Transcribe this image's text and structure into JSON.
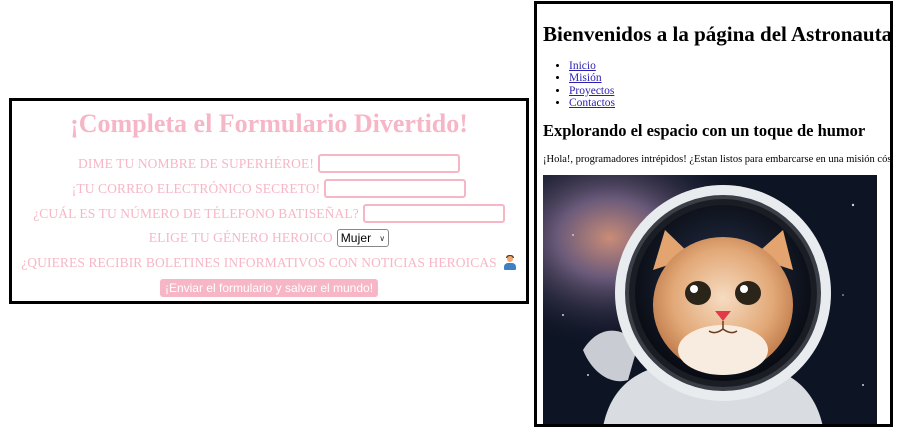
{
  "form": {
    "title": "¡Completa el Formulario Divertido!",
    "fields": [
      {
        "label": "DIME TU NOMBRE DE SUPERHÉROE!",
        "value": ""
      },
      {
        "label": "¡TU CORREO ELECTRÓNICO SECRETO!",
        "value": ""
      },
      {
        "label": "¿CUÁL ES TU NÚMERO DE TÉLEFONO BATISEÑAL?",
        "value": ""
      }
    ],
    "gender": {
      "label": "ELIGE TU GÉNERO HEROICO",
      "selected": "Mujer"
    },
    "newsletter": {
      "label": "¿QUIERES RECIBIR BOLETINES INFORMATIVOS CON NOTICIAS HEROICAS",
      "icon": "person-icon"
    },
    "submit_label": "¡Enviar el formulario y salvar el mundo!",
    "accent_color": "#f7b6c6"
  },
  "page": {
    "title": "Bienvenidos a la página del Astronauta",
    "nav": [
      "Inicio",
      "Misión",
      "Proyectos",
      "Contactos"
    ],
    "section_title": "Explorando el espacio con un toque de humor",
    "intro": "¡Hola!, programadores intrépidos! ¿Estan listos para embarcarse en una misión cósmica",
    "image": {
      "subject": "cat in astronaut helmet",
      "icon": "astronaut-cat-image"
    }
  }
}
